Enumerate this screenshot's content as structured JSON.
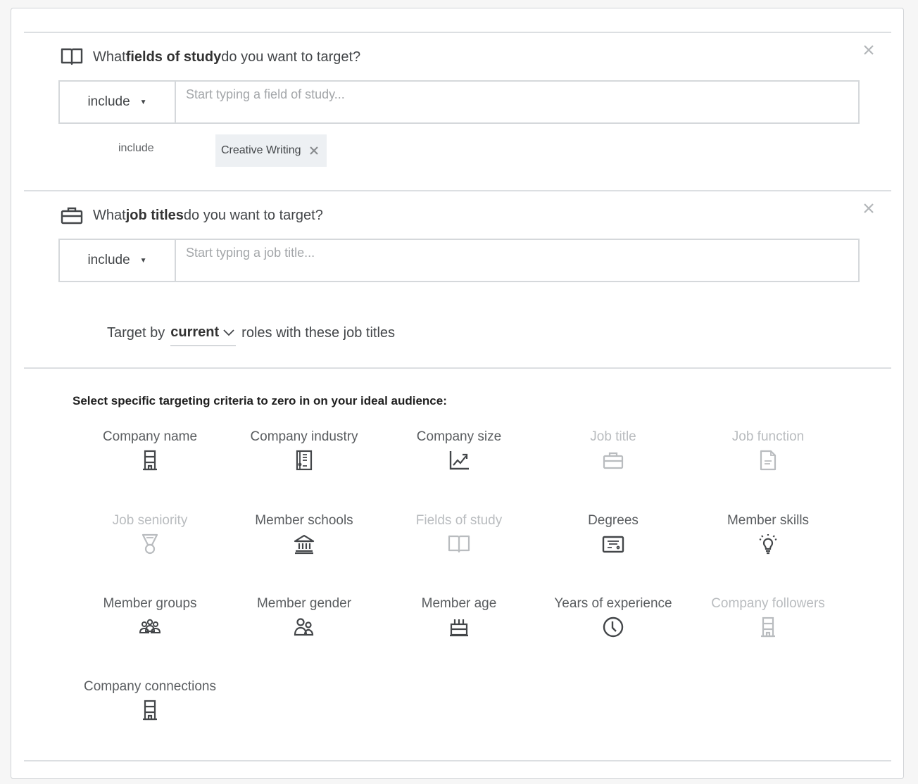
{
  "fields_of_study": {
    "title_pre": "What ",
    "title_bold": "fields of study",
    "title_post": " do you want to target?",
    "mode": "include",
    "placeholder": "Start typing a field of study...",
    "selected_label": "include",
    "selected": [
      {
        "label": "Creative Writing"
      }
    ]
  },
  "job_titles": {
    "title_pre": "What ",
    "title_bold": "job titles",
    "title_post": " do you want to target?",
    "mode": "include",
    "placeholder": "Start typing a job title...",
    "target_by_pre": "Target by",
    "target_by_value": "current",
    "target_by_post": "roles with these job titles"
  },
  "criteria": {
    "heading": "Select specific targeting criteria to zero in on your ideal audience:",
    "items": [
      {
        "label": "Company name",
        "icon": "building-icon",
        "enabled": true
      },
      {
        "label": "Company industry",
        "icon": "industry-icon",
        "enabled": true
      },
      {
        "label": "Company size",
        "icon": "growth-chart-icon",
        "enabled": true
      },
      {
        "label": "Job title",
        "icon": "briefcase-icon",
        "enabled": false
      },
      {
        "label": "Job function",
        "icon": "document-icon",
        "enabled": false
      },
      {
        "label": "Job seniority",
        "icon": "medal-icon",
        "enabled": false
      },
      {
        "label": "Member schools",
        "icon": "school-icon",
        "enabled": true
      },
      {
        "label": "Fields of study",
        "icon": "book-icon",
        "enabled": false
      },
      {
        "label": "Degrees",
        "icon": "certificate-icon",
        "enabled": true
      },
      {
        "label": "Member skills",
        "icon": "lightbulb-icon",
        "enabled": true
      },
      {
        "label": "Member groups",
        "icon": "group-icon",
        "enabled": true
      },
      {
        "label": "Member gender",
        "icon": "people-icon",
        "enabled": true
      },
      {
        "label": "Member age",
        "icon": "cake-icon",
        "enabled": true
      },
      {
        "label": "Years of experience",
        "icon": "clock-icon",
        "enabled": true
      },
      {
        "label": "Company followers",
        "icon": "building-icon",
        "enabled": false
      },
      {
        "label": "Company connections",
        "icon": "building-icon",
        "enabled": true
      }
    ]
  }
}
